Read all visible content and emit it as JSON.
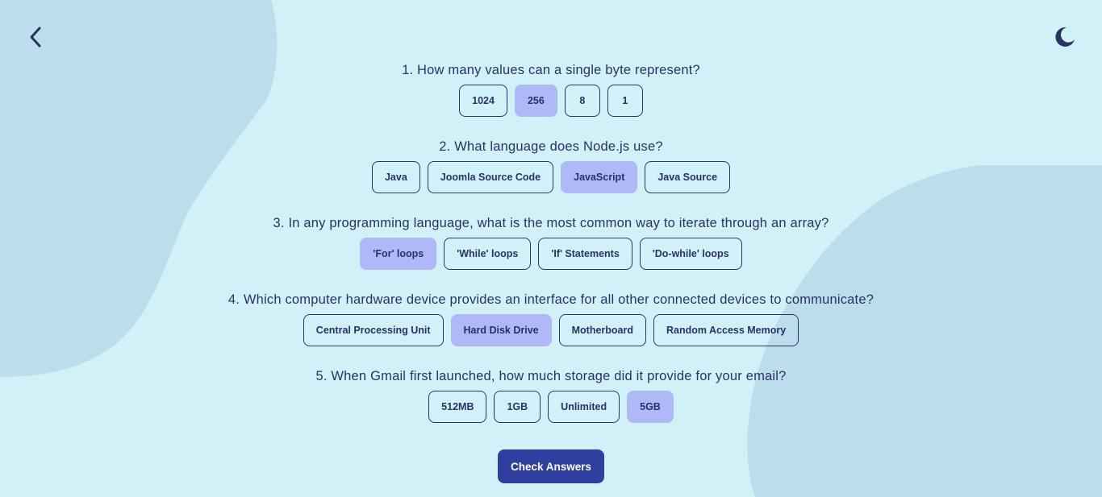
{
  "nav": {
    "back_icon": "chevron-left-icon",
    "theme_icon": "moon-icon"
  },
  "colors": {
    "background": "#d1f1f8",
    "blob": "#bcdeec",
    "text": "#293264",
    "selected": "#b0b9f8",
    "button": "#2f3fa0"
  },
  "questions": [
    {
      "text": "1. How many values can a single byte represent?",
      "answers": [
        {
          "label": "1024",
          "selected": false
        },
        {
          "label": "256",
          "selected": true
        },
        {
          "label": "8",
          "selected": false
        },
        {
          "label": "1",
          "selected": false
        }
      ]
    },
    {
      "text": "2. What language does Node.js use?",
      "answers": [
        {
          "label": "Java",
          "selected": false
        },
        {
          "label": "Joomla Source Code",
          "selected": false
        },
        {
          "label": "JavaScript",
          "selected": true
        },
        {
          "label": "Java Source",
          "selected": false
        }
      ]
    },
    {
      "text": "3. In any programming language, what is the most common way to iterate through an array?",
      "answers": [
        {
          "label": "'For' loops",
          "selected": true
        },
        {
          "label": "'While' loops",
          "selected": false
        },
        {
          "label": "'If' Statements",
          "selected": false
        },
        {
          "label": "'Do-while' loops",
          "selected": false
        }
      ]
    },
    {
      "text": "4. Which computer hardware device provides an interface for all other connected devices to communicate?",
      "answers": [
        {
          "label": "Central Processing Unit",
          "selected": false
        },
        {
          "label": "Hard Disk Drive",
          "selected": true
        },
        {
          "label": "Motherboard",
          "selected": false
        },
        {
          "label": "Random Access Memory",
          "selected": false
        }
      ]
    },
    {
      "text": "5. When Gmail first launched, how much storage did it provide for your email?",
      "answers": [
        {
          "label": "512MB",
          "selected": false
        },
        {
          "label": "1GB",
          "selected": false
        },
        {
          "label": "Unlimited",
          "selected": false
        },
        {
          "label": "5GB",
          "selected": true
        }
      ]
    }
  ],
  "actions": {
    "check_label": "Check Answers"
  }
}
